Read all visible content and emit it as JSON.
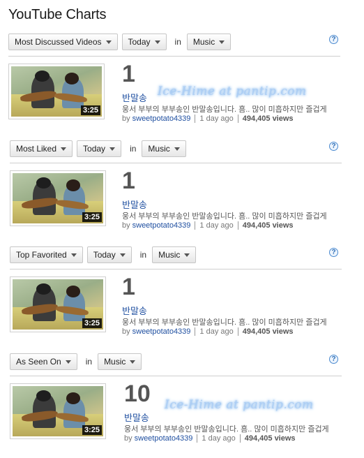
{
  "page": {
    "title": "YouTube Charts"
  },
  "help_label": "?",
  "in_word": "in",
  "sections": [
    {
      "filters": [
        "Most Discussed Videos",
        "Today",
        "Music"
      ],
      "video": {
        "rank": "1",
        "title": "반말송",
        "description": "웅서 부부의 부부송인 반말송입니다. 흠.. 많이 미흡하지만 즐겁게",
        "by": "by",
        "user": "sweetpotato4339",
        "age": "1 day ago",
        "views": "494,405 views",
        "duration": "3:25"
      }
    },
    {
      "filters": [
        "Most Liked",
        "Today",
        "Music"
      ],
      "video": {
        "rank": "1",
        "title": "반말송",
        "description": "웅서 부부의 부부송인 반말송입니다. 흠.. 많이 미흡하지만 즐겁게",
        "by": "by",
        "user": "sweetpotato4339",
        "age": "1 day ago",
        "views": "494,405 views",
        "duration": "3:25"
      }
    },
    {
      "filters": [
        "Top Favorited",
        "Today",
        "Music"
      ],
      "video": {
        "rank": "1",
        "title": "반말송",
        "description": "웅서 부부의 부부송인 반말송입니다. 흠.. 많이 미흡하지만 즐겁게",
        "by": "by",
        "user": "sweetpotato4339",
        "age": "1 day ago",
        "views": "494,405 views",
        "duration": "3:25"
      }
    },
    {
      "filters": [
        "As Seen On",
        "Music"
      ],
      "video": {
        "rank": "10",
        "title": "반말송",
        "description": "웅서 부부의 부부송인 반말송입니다. 흠.. 많이 미흡하지만 즐겁게",
        "by": "by",
        "user": "sweetpotato4339",
        "age": "1 day ago",
        "views": "494,405 views",
        "duration": "3:25"
      }
    }
  ],
  "watermark": "Ice-Hime at pantip.com"
}
